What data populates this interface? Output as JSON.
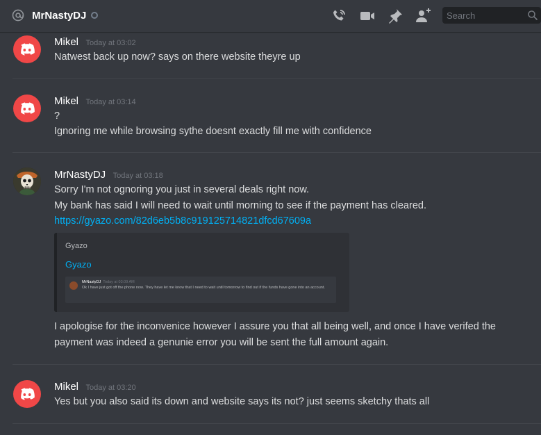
{
  "header": {
    "channel_name": "MrNastyDJ",
    "search_placeholder": "Search",
    "icons": [
      "at-icon",
      "status-offline-icon",
      "call-icon",
      "video-call-icon",
      "pin-icon",
      "add-friend-icon",
      "search-icon"
    ]
  },
  "colors": {
    "background": "#36393f",
    "link": "#00b0f4",
    "discord_red": "#f04747",
    "timestamp": "#72767d",
    "divider": "#42454b",
    "embed_bg": "#2f3136"
  },
  "messages": [
    {
      "username": "Mikel",
      "timestamp": "Today at 03:02",
      "avatar": "discord-default-avatar",
      "lines": [
        "Natwest back up now? says on there website theyre up"
      ]
    },
    {
      "username": "Mikel",
      "timestamp": "Today at 03:14",
      "avatar": "discord-default-avatar",
      "lines": [
        "?",
        "Ignoring me while browsing sythe doesnt exactly fill me with confidence"
      ]
    },
    {
      "username": "MrNastyDJ",
      "timestamp": "Today at 03:18",
      "avatar": "skull-avatar",
      "lines": [
        "Sorry I'm not ognoring you just in several deals right now.",
        "My bank has said I will need to wait until morning to see if the payment has cleared."
      ],
      "link": "https://gyazo.com/82d6eb5b8c919125714821dfcd67609a",
      "embed": {
        "provider": "Gyazo",
        "title": "Gyazo",
        "thumbnail": {
          "username": "MrNastyDJ",
          "timestamp": "Today at 03:09 AM",
          "text": "Ok I have just got off the phone now. They have let me know that I need to wait until tomorrow to find out if the funds have gone into an account."
        }
      },
      "after_lines": [
        "I apologise for the inconvenice however I assure you that all being well, and once I have verifed the",
        "payment was indeed a genunie error you will be sent the full amount again."
      ]
    },
    {
      "username": "Mikel",
      "timestamp": "Today at 03:20",
      "avatar": "discord-default-avatar",
      "lines": [
        "Yes but you also said its down and website says its not? just seems sketchy thats all"
      ]
    }
  ]
}
